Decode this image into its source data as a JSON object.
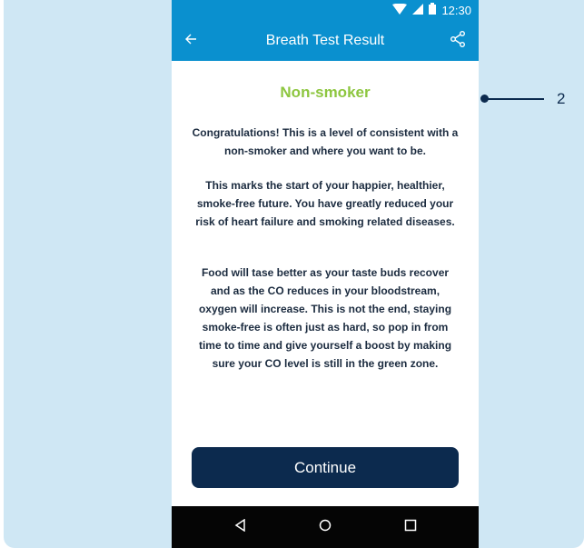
{
  "status_bar": {
    "time": "12:30"
  },
  "app_bar": {
    "title": "Breath Test Result",
    "back_icon": "arrow-left-icon",
    "share_icon": "share-icon"
  },
  "result": {
    "title": "Non-smoker",
    "title_color": "#8dc63f",
    "paragraphs": [
      "Congratulations! This is a level of consistent with a non-smoker and where you want to be.",
      "This marks the start of your happier, healthier, smoke-free future. You have greatly reduced your risk of heart failure and smoking related diseases.",
      "Food will tase better as your taste buds recover and as the CO reduces in your bloodstream, oxygen will increase. This is not the end, staying smoke-free is often just as hard, so pop in from time to time and give yourself a boost by making sure your CO level is still in the green zone."
    ]
  },
  "actions": {
    "continue_label": "Continue"
  },
  "callout": {
    "number": "2"
  },
  "colors": {
    "accent": "#0a90cf",
    "button": "#0c2a4e",
    "backdrop": "#cfe7f4"
  }
}
